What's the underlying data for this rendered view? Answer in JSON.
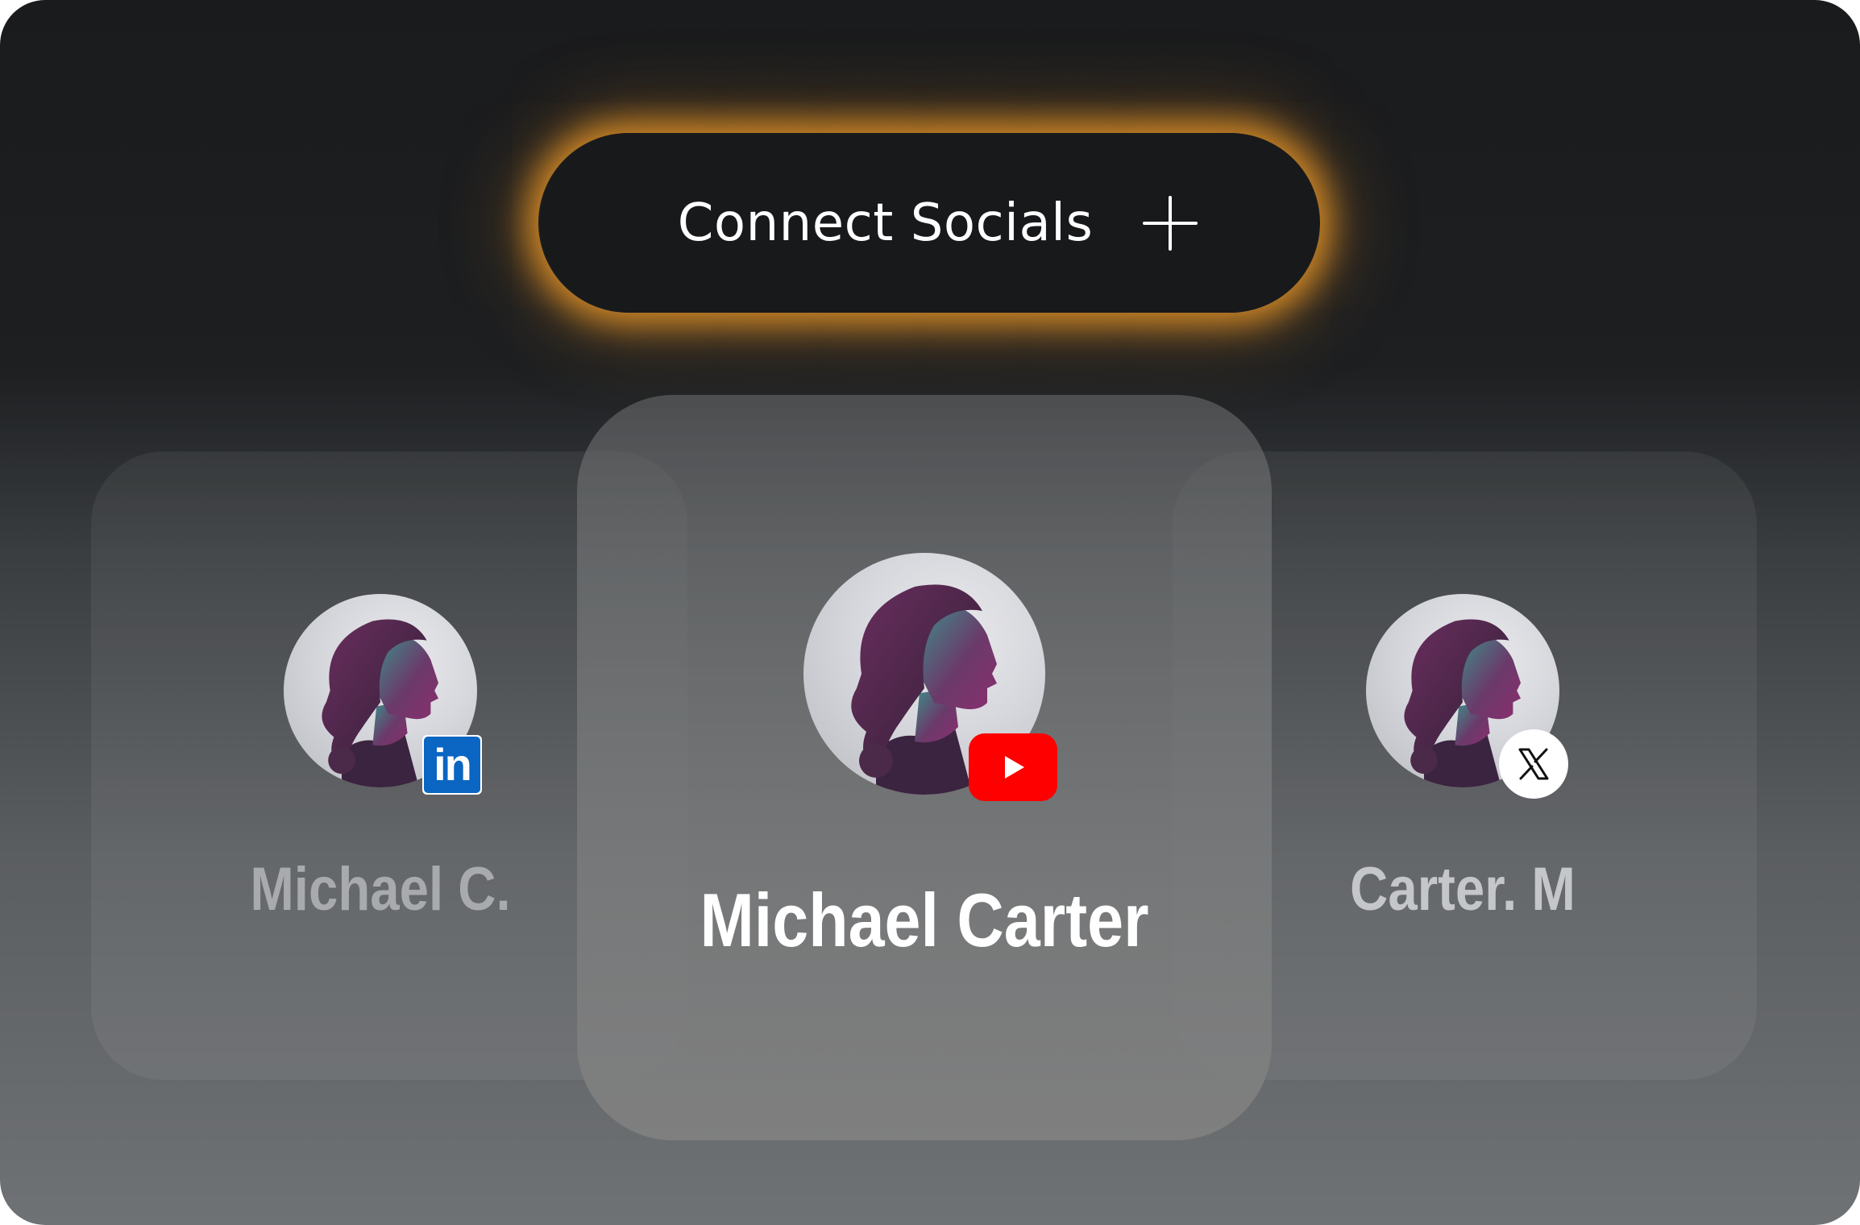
{
  "connect_button": {
    "label": "Connect Socials",
    "icon": "plus-icon",
    "glow_color": "#e8962a"
  },
  "profiles": [
    {
      "name": "Michael C.",
      "platform": "LinkedIn",
      "badge_icon": "linkedin-icon",
      "badge_text": "in",
      "badge_color": "#0a66c2",
      "selected": false
    },
    {
      "name": "Michael Carter",
      "platform": "YouTube",
      "badge_icon": "youtube-icon",
      "badge_color": "#ff0000",
      "selected": true
    },
    {
      "name": "Carter. M",
      "platform": "X",
      "badge_icon": "x-icon",
      "badge_color": "#ffffff",
      "selected": false
    }
  ]
}
